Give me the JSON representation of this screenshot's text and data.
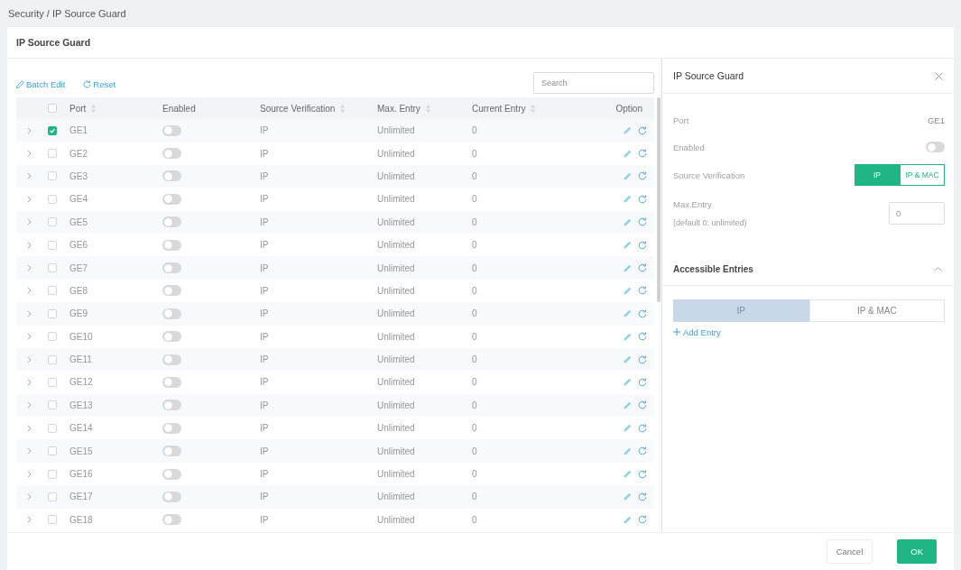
{
  "breadcrumb": "Security / IP Source Guard",
  "page_title": "IP Source Guard",
  "toolbar": {
    "batch_edit": "Batch Edit",
    "reset": "Reset",
    "search": {
      "placeholder": "Search"
    }
  },
  "table": {
    "header_checked": false,
    "columns": [
      {
        "label": "Port",
        "sortable": true
      },
      {
        "label": "Enabled",
        "sortable": false
      },
      {
        "label": "Source Verification",
        "sortable": true
      },
      {
        "label": "Max. Entry",
        "sortable": true
      },
      {
        "label": "Current Entry",
        "sortable": true
      },
      {
        "label": "Option",
        "sortable": false
      }
    ],
    "rows": [
      {
        "port": "GE1",
        "expanded": false,
        "checked": true,
        "enabled": false,
        "source_verification": "IP",
        "max_entry": "Unlimited",
        "current_entry": "0"
      },
      {
        "port": "GE2",
        "expanded": false,
        "checked": false,
        "enabled": false,
        "source_verification": "IP",
        "max_entry": "Unlimited",
        "current_entry": "0"
      },
      {
        "port": "GE3",
        "expanded": false,
        "checked": false,
        "enabled": false,
        "source_verification": "IP",
        "max_entry": "Unlimited",
        "current_entry": "0"
      },
      {
        "port": "GE4",
        "expanded": false,
        "checked": false,
        "enabled": false,
        "source_verification": "IP",
        "max_entry": "Unlimited",
        "current_entry": "0"
      },
      {
        "port": "GE5",
        "expanded": false,
        "checked": false,
        "enabled": false,
        "source_verification": "IP",
        "max_entry": "Unlimited",
        "current_entry": "0"
      },
      {
        "port": "GE6",
        "expanded": false,
        "checked": false,
        "enabled": false,
        "source_verification": "IP",
        "max_entry": "Unlimited",
        "current_entry": "0"
      },
      {
        "port": "GE7",
        "expanded": false,
        "checked": false,
        "enabled": false,
        "source_verification": "IP",
        "max_entry": "Unlimited",
        "current_entry": "0"
      },
      {
        "port": "GE8",
        "expanded": false,
        "checked": false,
        "enabled": false,
        "source_verification": "IP",
        "max_entry": "Unlimited",
        "current_entry": "0"
      },
      {
        "port": "GE9",
        "expanded": false,
        "checked": false,
        "enabled": false,
        "source_verification": "IP",
        "max_entry": "Unlimited",
        "current_entry": "0"
      },
      {
        "port": "GE10",
        "expanded": false,
        "checked": false,
        "enabled": false,
        "source_verification": "IP",
        "max_entry": "Unlimited",
        "current_entry": "0"
      },
      {
        "port": "GE11",
        "expanded": false,
        "checked": false,
        "enabled": false,
        "source_verification": "IP",
        "max_entry": "Unlimited",
        "current_entry": "0"
      },
      {
        "port": "GE12",
        "expanded": false,
        "checked": false,
        "enabled": false,
        "source_verification": "IP",
        "max_entry": "Unlimited",
        "current_entry": "0"
      },
      {
        "port": "GE13",
        "expanded": false,
        "checked": false,
        "enabled": false,
        "source_verification": "IP",
        "max_entry": "Unlimited",
        "current_entry": "0"
      },
      {
        "port": "GE14",
        "expanded": false,
        "checked": false,
        "enabled": false,
        "source_verification": "IP",
        "max_entry": "Unlimited",
        "current_entry": "0"
      },
      {
        "port": "GE15",
        "expanded": false,
        "checked": false,
        "enabled": false,
        "source_verification": "IP",
        "max_entry": "Unlimited",
        "current_entry": "0"
      },
      {
        "port": "GE16",
        "expanded": false,
        "checked": false,
        "enabled": false,
        "source_verification": "IP",
        "max_entry": "Unlimited",
        "current_entry": "0"
      },
      {
        "port": "GE17",
        "expanded": false,
        "checked": false,
        "enabled": false,
        "source_verification": "IP",
        "max_entry": "Unlimited",
        "current_entry": "0"
      },
      {
        "port": "GE18",
        "expanded": false,
        "checked": false,
        "enabled": false,
        "source_verification": "IP",
        "max_entry": "Unlimited",
        "current_entry": "0"
      }
    ]
  },
  "panel": {
    "title": "IP Source Guard",
    "fields": [
      {
        "kind": "text",
        "label": "Port",
        "value": "GE1"
      },
      {
        "kind": "toggle",
        "label": "Enabled",
        "on": false
      },
      {
        "kind": "segmented",
        "label": "Source Verification",
        "options": [
          {
            "label": "IP",
            "selected": true
          },
          {
            "label": "IP & MAC",
            "selected": false
          }
        ]
      },
      {
        "kind": "input",
        "label": "Max.Entry",
        "hint": "(default 0: unlimited)",
        "value": "0"
      }
    ],
    "section": {
      "title": "Accessible Entries",
      "expanded": true
    },
    "tabs": [
      {
        "label": "IP",
        "selected": true
      },
      {
        "label": "IP & MAC",
        "selected": false
      }
    ],
    "add_entry": "Add Entry"
  },
  "footer": {
    "buttons": [
      {
        "label": "Cancel",
        "kind": "secondary"
      },
      {
        "label": "OK",
        "kind": "primary"
      }
    ]
  }
}
